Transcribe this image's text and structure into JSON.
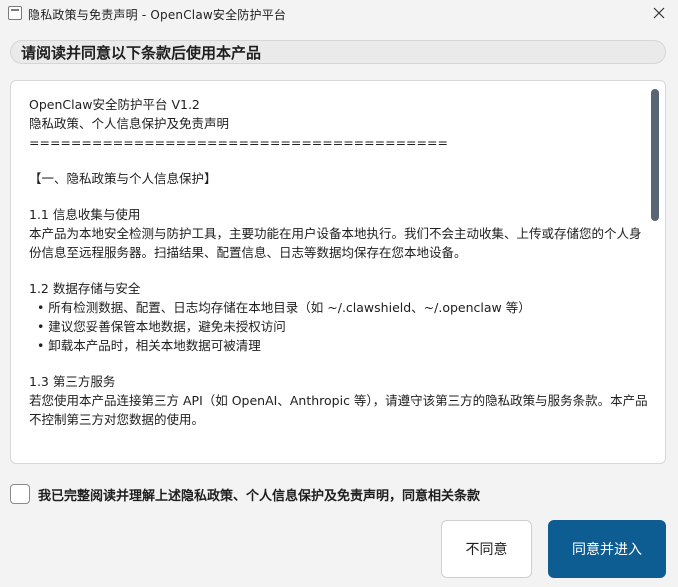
{
  "window": {
    "title": "隐私政策与免责声明 - OpenClaw安全防护平台",
    "icon": "app-icon",
    "close_icon": "close-icon"
  },
  "heading": "请阅读并同意以下条款后使用本产品",
  "terms": {
    "title": "OpenClaw安全防护平台 V1.2",
    "subtitle": "隐私政策、个人信息保护及免责声明",
    "divider": "========================================",
    "section1": "【一、隐私政策与个人信息保护】",
    "s1_1_title": "1.1 信息收集与使用",
    "s1_1_body": "  本产品为本地安全检测与防护工具，主要功能在用户设备本地执行。我们不会主动收集、上传或存储您的个人身份信息至远程服务器。扫描结果、配置信息、日志等数据均保存在您本地设备。",
    "s1_2_title": "1.2 数据存储与安全",
    "s1_2_items": [
      "  • 所有检测数据、配置、日志均存储在本地目录（如 ~/.clawshield、~/.openclaw 等）",
      "  • 建议您妥善保管本地数据，避免未授权访问",
      "  • 卸载本产品时，相关本地数据可被清理"
    ],
    "s1_3_title": "1.3 第三方服务",
    "s1_3_body": "  若您使用本产品连接第三方 API（如 OpenAI、Anthropic 等），请遵守该第三方的隐私政策与服务条款。本产品不控制第三方对您数据的使用。"
  },
  "agree_checkbox": {
    "checked": false,
    "label": "我已完整阅读并理解上述隐私政策、个人信息保护及免责声明，同意相关条款"
  },
  "buttons": {
    "decline": "不同意",
    "accept": "同意并进入"
  },
  "colors": {
    "accent": "#0d5c92",
    "scrollbar": "#5a6573",
    "background": "#f3f3f3"
  }
}
